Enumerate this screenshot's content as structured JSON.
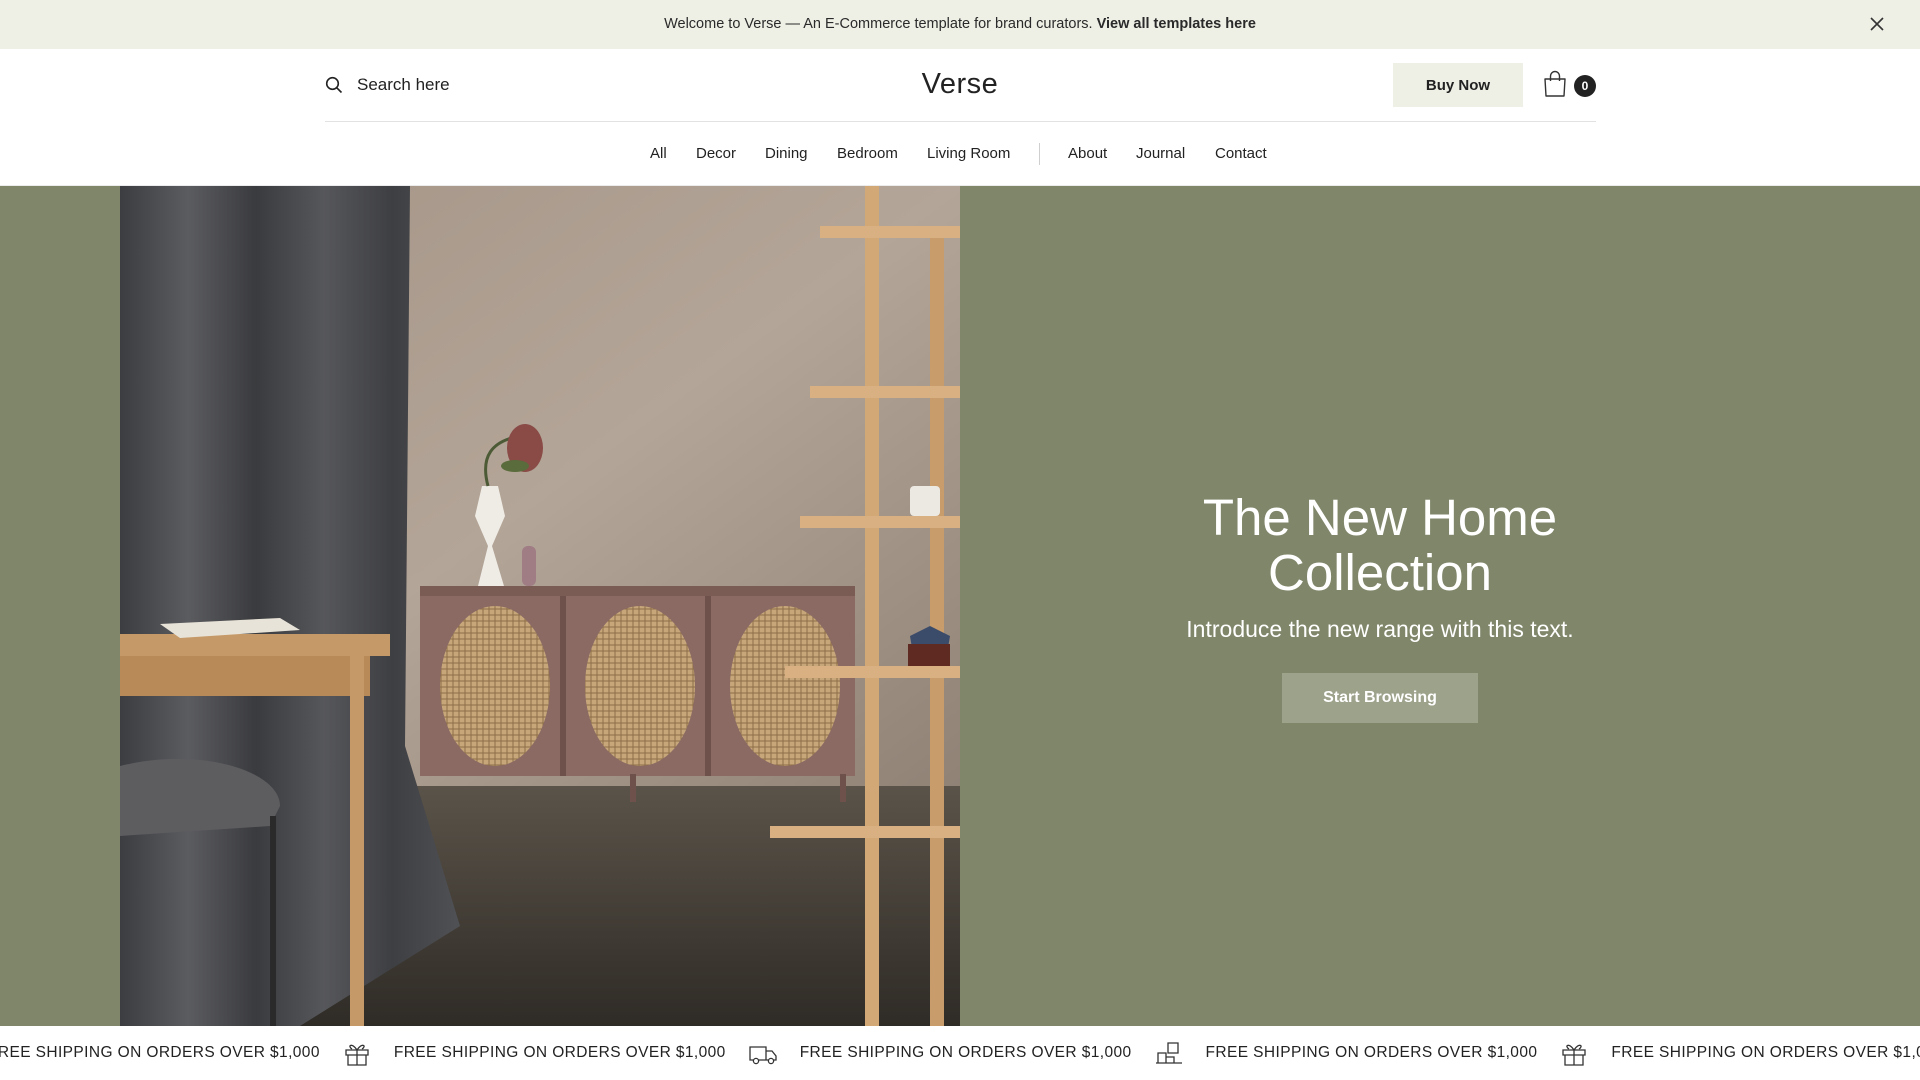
{
  "announcement": {
    "text": "Welcome to Verse — An E-Commerce template for brand curators.",
    "link": "View all templates here",
    "close_icon": "close-icon"
  },
  "header": {
    "search_placeholder": "Search here",
    "search_icon": "search-icon",
    "logo": "Verse",
    "buy_now": "Buy Now",
    "cart_icon": "shopping-bag-icon",
    "cart_count": "0"
  },
  "nav": {
    "items": [
      "All",
      "Decor",
      "Dining",
      "Bedroom",
      "Living Room",
      "About",
      "Journal",
      "Contact"
    ]
  },
  "hero": {
    "title_line1": "The New Home",
    "title_line2": "Collection",
    "subtitle": "Introduce the new range with this text.",
    "button": "Start Browsing",
    "image_alt": "furniture-scene-image",
    "bg_color": "#7f8669"
  },
  "marquee": {
    "text": "FREE SHIPPING ON ORDERS OVER $1,000",
    "icons": [
      "gift-box-icon",
      "delivery-truck-icon",
      "shipping-package-icon",
      "gift-box-icon",
      "delivery-truck-icon"
    ]
  },
  "colors": {
    "announcement_bg": "#eef0e6",
    "hero_bg": "#7f8669",
    "hero_button": "#9da28b",
    "text": "#222222"
  }
}
